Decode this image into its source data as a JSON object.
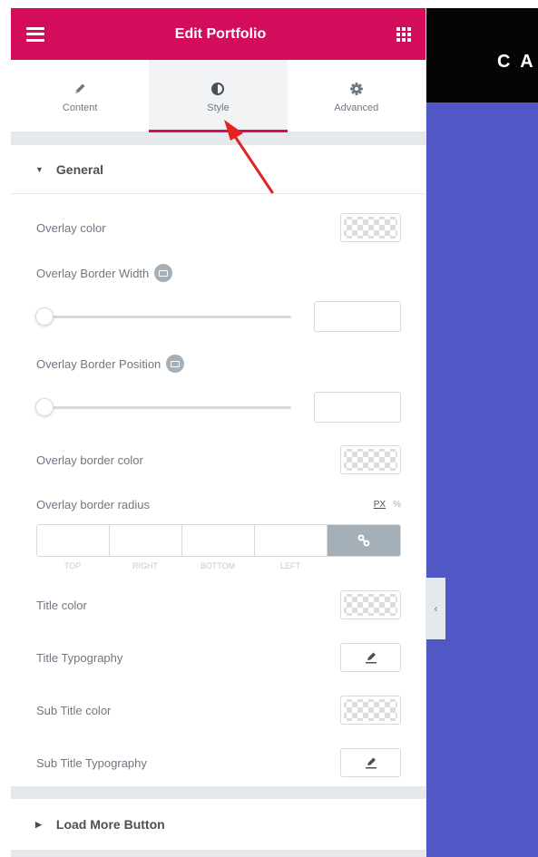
{
  "header": {
    "title": "Edit Portfolio"
  },
  "tabs": [
    {
      "label": "Content",
      "icon": "pencil-icon",
      "active": false
    },
    {
      "label": "Style",
      "icon": "contrast-icon",
      "active": true
    },
    {
      "label": "Advanced",
      "icon": "gear-icon",
      "active": false
    }
  ],
  "section_general": {
    "title": "General",
    "expanded": true
  },
  "controls": {
    "overlay_color": "Overlay color",
    "overlay_border_width": "Overlay Border Width",
    "overlay_border_position": "Overlay Border Position",
    "overlay_border_color": "Overlay border color",
    "overlay_border_radius": "Overlay border radius",
    "title_color": "Title color",
    "title_typography": "Title Typography",
    "sub_title_color": "Sub Title color",
    "sub_title_typography": "Sub Title Typography"
  },
  "units": {
    "px": "PX",
    "percent": "%"
  },
  "dimensions": [
    "Top",
    "Right",
    "Bottom",
    "Left"
  ],
  "section_load_more": {
    "title": "Load More Button",
    "expanded": false
  },
  "preview": {
    "brand_text": "C A"
  },
  "colors": {
    "accent": "#d30c5c",
    "preview_bg": "#5157c4",
    "arrow": "#e3231f"
  }
}
